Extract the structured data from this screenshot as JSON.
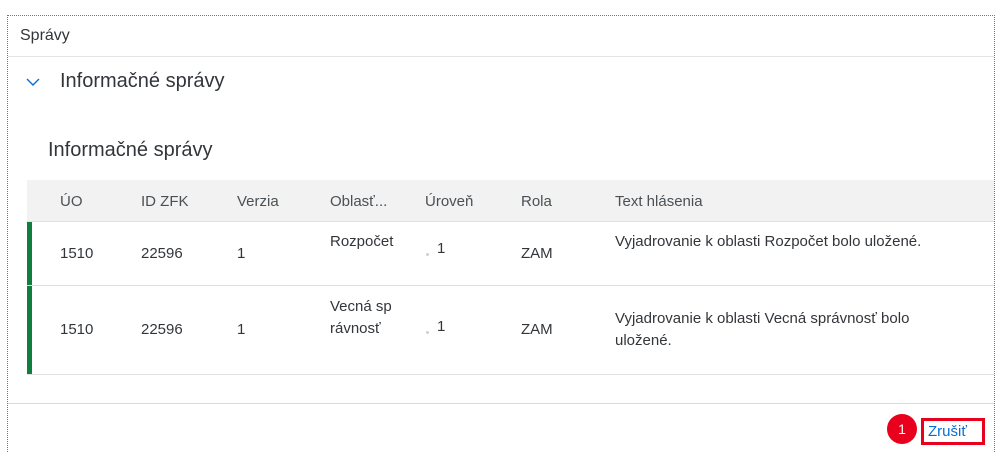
{
  "dialog": {
    "title": "Správy"
  },
  "panel": {
    "title": "Informačné správy",
    "expanded": true
  },
  "table": {
    "title": "Informačné správy",
    "columns": [
      "ÚO",
      "ID ZFK",
      "Verzia",
      "Oblasť...",
      "Úroveň",
      "Rola",
      "Text hlásenia"
    ],
    "rows": [
      {
        "uo": "1510",
        "id_zfk": "22596",
        "verzia": "1",
        "oblast": "Rozpočet",
        "uroven": "1",
        "rola": "ZAM",
        "text": "Vyjadrovanie k oblasti Rozpočet bolo uložené.",
        "status_color": "#107e3e"
      },
      {
        "uo": "1510",
        "id_zfk": "22596",
        "verzia": "1",
        "oblast": "Vecná správnosť",
        "uroven": "1",
        "rola": "ZAM",
        "text": "Vyjadrovanie k oblasti Vecná správnosť bolo uložené.",
        "status_color": "#107e3e"
      }
    ]
  },
  "footer": {
    "cancel_label": "Zrušiť",
    "step_badge": "1"
  },
  "colors": {
    "accent": "#0a6ed1",
    "success": "#107e3e",
    "highlight_red": "#e8001c"
  },
  "icons": {
    "panel_toggle": "chevron-down-icon"
  }
}
